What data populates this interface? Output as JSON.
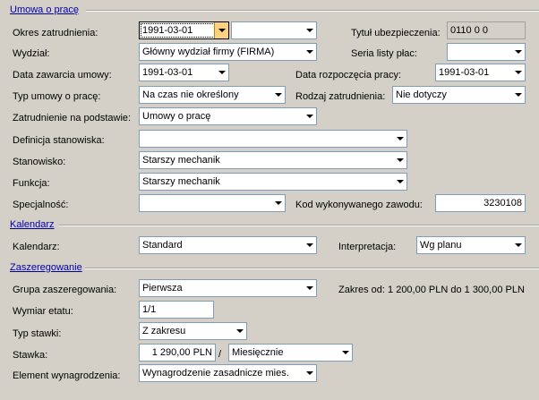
{
  "sections": {
    "umowa": "Umowa o pracę",
    "kalendarz": "Kalendarz",
    "zaszeregowanie": "Zaszeregowanie"
  },
  "umowa": {
    "okres_label": "Okres zatrudnienia:",
    "okres_value": "1991-03-01",
    "okres_value2": "",
    "tytul_label": "Tytuł ubezpieczenia:",
    "tytul_value": "0110 0 0",
    "wydzial_label": "Wydział:",
    "wydzial_value": "Główny wydział firmy (FIRMA)",
    "seria_label": "Seria listy płac:",
    "seria_value": "",
    "data_zawarcia_label": "Data zawarcia umowy:",
    "data_zawarcia_value": "1991-03-01",
    "data_rozpoczecia_label": "Data rozpoczęcia pracy:",
    "data_rozpoczecia_value": "1991-03-01",
    "typ_umowy_label": "Typ umowy o pracę:",
    "typ_umowy_value": "Na czas nie określony",
    "rodzaj_label": "Rodzaj zatrudnienia:",
    "rodzaj_value": "Nie dotyczy",
    "zatrudnienie_label": "Zatrudnienie na podstawie:",
    "zatrudnienie_value": "Umowy o pracę",
    "definicja_label": "Definicja stanowiska:",
    "definicja_value": "",
    "stanowisko_label": "Stanowisko:",
    "stanowisko_value": "Starszy mechanik",
    "funkcja_label": "Funkcja:",
    "funkcja_value": "Starszy mechanik",
    "specjalnosc_label": "Specjalność:",
    "specjalnosc_value": "",
    "kod_label": "Kod wykonywanego zawodu:",
    "kod_value": "3230108"
  },
  "kalendarz": {
    "kalendarz_label": "Kalendarz:",
    "kalendarz_value": "Standard",
    "interpretacja_label": "Interpretacja:",
    "interpretacja_value": "Wg planu"
  },
  "zaszeregowanie": {
    "grupa_label": "Grupa zaszeregowania:",
    "grupa_value": "Pierwsza",
    "zakres_text": "Zakres od: 1 200,00 PLN do 1 300,00 PLN",
    "wymiar_label": "Wymiar etatu:",
    "wymiar_value": "1/1",
    "typ_stawki_label": "Typ stawki:",
    "typ_stawki_value": "Z zakresu",
    "stawka_label": "Stawka:",
    "stawka_value": "1 290,00 PLN",
    "stawka_sep": "/",
    "okres_stawki_value": "Miesięcznie",
    "element_label": "Element wynagrodzenia:",
    "element_value": "Wynagrodzenie zasadnicze mies."
  }
}
